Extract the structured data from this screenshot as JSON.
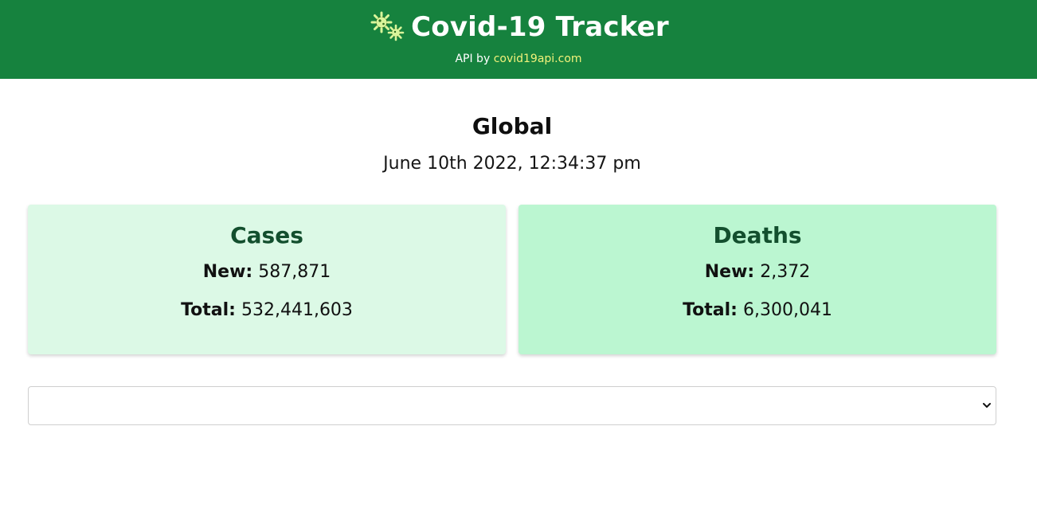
{
  "header": {
    "title": "Covid-19 Tracker",
    "logo_icon": "virus-icon",
    "api_prefix": "API by",
    "api_link_text": "covid19api.com",
    "background_color": "#16823e",
    "link_color": "#f2f27a"
  },
  "summary": {
    "region": "Global",
    "timestamp": "June 10th 2022, 12:34:37 pm"
  },
  "cards": {
    "cases": {
      "title": "Cases",
      "new_label": "New:",
      "new_value": "587,871",
      "total_label": "Total:",
      "total_value": "532,441,603",
      "background_color": "#dcf9e6"
    },
    "deaths": {
      "title": "Deaths",
      "new_label": "New:",
      "new_value": "2,372",
      "total_label": "Total:",
      "total_value": "6,300,041",
      "background_color": "#bbf6d1"
    }
  },
  "country_select": {
    "selected_value": "",
    "icon": "chevron-down-icon"
  }
}
